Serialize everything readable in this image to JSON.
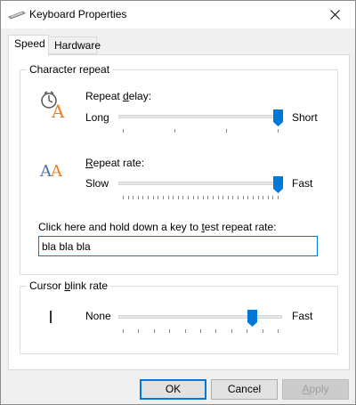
{
  "window": {
    "title": "Keyboard Properties"
  },
  "tabs": [
    {
      "label": "Speed",
      "active": true
    },
    {
      "label": "Hardware",
      "active": false
    }
  ],
  "character_repeat": {
    "legend": "Character repeat",
    "repeat_delay": {
      "label_prefix": "Repeat ",
      "label_underlined": "d",
      "label_suffix": "elay:",
      "min_label": "Long",
      "max_label": "Short",
      "value_fraction": 1.0
    },
    "repeat_rate": {
      "label_underlined": "R",
      "label_suffix": "epeat rate:",
      "min_label": "Slow",
      "max_label": "Fast",
      "value_fraction": 1.0
    },
    "test": {
      "prompt_prefix": "Click here and hold down a key to ",
      "prompt_underlined": "t",
      "prompt_suffix": "est repeat rate:",
      "value": "bla bla bla"
    }
  },
  "cursor_blink": {
    "legend_prefix": "Cursor ",
    "legend_underlined": "b",
    "legend_suffix": "link rate",
    "min_label": "None",
    "max_label": "Fast",
    "value_fraction": 0.82
  },
  "buttons": {
    "ok": "OK",
    "cancel": "Cancel",
    "apply_prefix": "",
    "apply_underlined": "A",
    "apply_suffix": "pply"
  },
  "colors": {
    "accent": "#0078d7",
    "icon_orange": "#e8802a",
    "icon_blue": "#4f6fa5"
  }
}
